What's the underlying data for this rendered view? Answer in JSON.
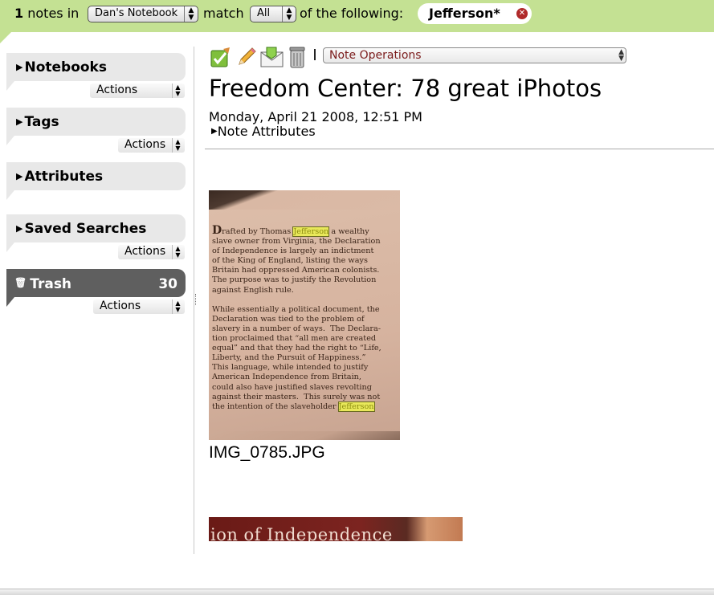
{
  "filter_bar": {
    "count": "1",
    "notes_in": "notes in",
    "notebook": "Dan's Notebook",
    "match": "match",
    "match_mode": "All",
    "of_following": "of the following:",
    "search_term": "Jefferson*"
  },
  "sidebar": {
    "notebooks": {
      "label": "Notebooks",
      "actions": "Actions"
    },
    "tags": {
      "label": "Tags",
      "actions": "Actions"
    },
    "attributes": {
      "label": "Attributes"
    },
    "saved_searches": {
      "label": "Saved Searches",
      "actions": "Actions"
    },
    "trash": {
      "label": "Trash",
      "count": "30",
      "actions": "Actions"
    }
  },
  "note": {
    "operations": "Note Operations",
    "title": "Freedom Center: 78 great iPhotos",
    "date": "Monday, April 21 2008, 12:51 PM",
    "attributes_label": "Note Attributes",
    "photo1": {
      "highlight": "Jefferson",
      "para1_lines": [
        "rafted by Thomas",
        "slave owner from Virginia, the Declaration",
        "of Independence is largely an indictment",
        "of the King of England, listing the ways",
        "Britain had oppressed American colonists.",
        "The purpose was to justify the Revolution",
        "against English rule."
      ],
      "para1_dropcap": "D",
      "para1_after_highlight": "a wealthy",
      "para2_lines": [
        "While essentially a political document, the",
        "Declaration was tied to the problem of",
        "slavery in a number of ways.  The Declara-",
        "tion proclaimed that “all men are created",
        "equal” and that they had the right to “Life,",
        "Liberty, and the Pursuit of Happiness.”",
        "This language, while intended to justify",
        "American Independence from Britain,",
        "could also have justified slaves revolting",
        "against their masters.  This surely was not",
        "the intention of the slaveholder"
      ],
      "caption": "IMG_0785.JPG"
    },
    "photo2": {
      "text": "ion of Independence"
    }
  },
  "icons": [
    "edit-note-icon",
    "pencil-icon",
    "email-icon",
    "trash-can-icon",
    "clear-search-icon"
  ],
  "colors": {
    "filter_bar": "#c4e193",
    "sidebar_section": "#e8e8e8",
    "trash_selected": "#5f5f5f",
    "highlight": "#e8e85a"
  }
}
